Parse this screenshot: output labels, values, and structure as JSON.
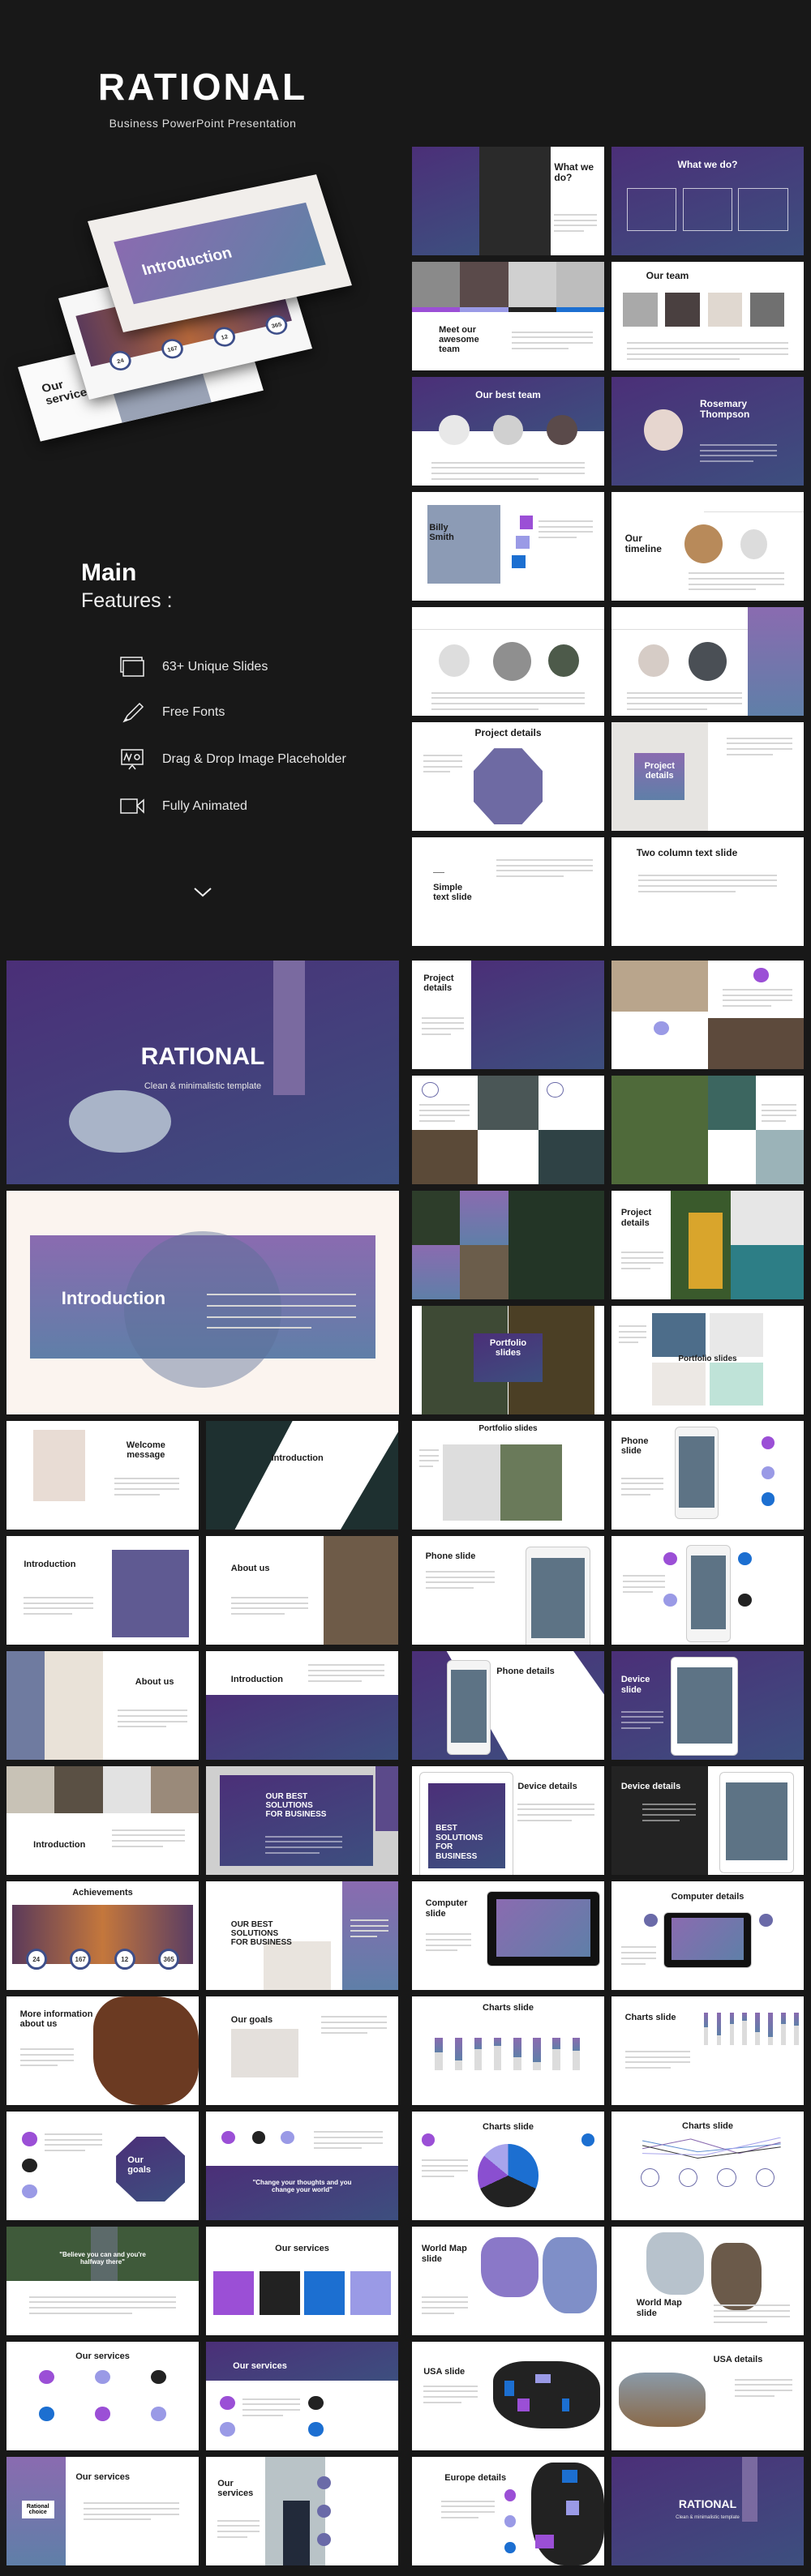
{
  "header": {
    "title": "RATIONAL",
    "subtitle": "Business PowerPoint Presentation"
  },
  "hero_cards": {
    "intro_title": "Introduction",
    "stats": [
      "24",
      "167",
      "12",
      "365"
    ],
    "services_title": "Our services"
  },
  "features": {
    "heading": "Main",
    "subheading": "Features :",
    "items": [
      {
        "label": "63+ Unique Slides",
        "icon": "slides-stack-icon"
      },
      {
        "label": "Free Fonts",
        "icon": "pen-icon"
      },
      {
        "label": "Drag & Drop Image Placeholder",
        "icon": "presentation-board-icon"
      },
      {
        "label": "Fully Animated",
        "icon": "video-camera-icon"
      }
    ],
    "scroll_icon": "chevron-down-icon"
  },
  "colors": {
    "background": "#181818",
    "purple": "#4b2f78",
    "violet": "#9b4fd6",
    "lavender": "#9a9ae6",
    "blue": "#1c6fd1"
  },
  "slides": {
    "whatwedo1": {
      "title": "What we\ndo?"
    },
    "whatwedo2": {
      "title": "What we do?"
    },
    "meet_team": {
      "title": "Meet our\nawesome\nteam"
    },
    "our_team": {
      "title": "Our team"
    },
    "best_team": {
      "title": "Our best team"
    },
    "rosemary": {
      "title": "Rosemary\nThompson"
    },
    "billy": {
      "title": "Billy\nSmith"
    },
    "timeline": {
      "title": "Our\ntimeline"
    },
    "timeline2": {
      "title": ""
    },
    "timeline3": {
      "title": ""
    },
    "project_oct": {
      "title": "Project details"
    },
    "project_box": {
      "title": "Project\ndetails"
    },
    "simple_text": {
      "title": "Simple\ntext slide"
    },
    "two_col": {
      "title": "Two column text slide"
    },
    "cover": {
      "title": "RATIONAL",
      "subtitle": "Clean & minimalistic template"
    },
    "intro_big": {
      "title": "Introduction"
    },
    "welcome": {
      "title": "Welcome\nmessage"
    },
    "intro2": {
      "title": "Introduction"
    },
    "intro3": {
      "title": "Introduction"
    },
    "about1": {
      "title": "About us"
    },
    "about2": {
      "title": "About us"
    },
    "intro4": {
      "title": "Introduction"
    },
    "intro5": {
      "title": "Introduction"
    },
    "solutions1": {
      "title": "OUR BEST\nSOLUTIONS\nFOR BUSINESS"
    },
    "achievements": {
      "title": "Achievements",
      "stats": [
        "24",
        "167",
        "12",
        "365"
      ]
    },
    "solutions2": {
      "title": "OUR BEST\nSOLUTIONS\nFOR BUSINESS"
    },
    "moreinfo": {
      "title": "More information\nabout us"
    },
    "goals1": {
      "title": "Our goals"
    },
    "goals2": {
      "title": "Our\ngoals"
    },
    "quote1": {
      "title": "\"Change your thoughts and you\nchange your world\""
    },
    "quote2": {
      "title": "\"Believe you can and you're\nhalfway there\""
    },
    "services1": {
      "title": "Our services"
    },
    "services2": {
      "title": "Our services"
    },
    "services3": {
      "title": "Our services"
    },
    "services4": {
      "title": "Our services",
      "subtitle": "Rational\nchoice"
    },
    "services5": {
      "title": "Our\nservices"
    },
    "pd1": {
      "title": "Project\ndetails"
    },
    "photos1": {
      "title": ""
    },
    "grid1": {
      "title": ""
    },
    "grid2": {
      "title": ""
    },
    "grid3": {
      "title": ""
    },
    "pd_parrot": {
      "title": "Project\ndetails"
    },
    "portfolio1": {
      "title": "Portfolio\nslides"
    },
    "portfolio2": {
      "title": "Portfolio slides"
    },
    "portfolio3": {
      "title": "Portfolio slides"
    },
    "phone1": {
      "title": "Phone\nslide"
    },
    "phone2": {
      "title": "Phone slide"
    },
    "phone3": {
      "title": ""
    },
    "phone_details": {
      "title": "Phone details"
    },
    "device_slide": {
      "title": "Device\nslide"
    },
    "device1": {
      "title": "Device details",
      "subtitle": "BEST\nSOLUTIONS\nFOR\nBUSINESS"
    },
    "device2": {
      "title": "Device details"
    },
    "computer1": {
      "title": "Computer\nslide"
    },
    "computer2": {
      "title": "Computer details"
    },
    "charts1": {
      "title": "Charts slide"
    },
    "charts2": {
      "title": "Charts slide"
    },
    "charts_pie": {
      "title": "Charts slide"
    },
    "charts_line": {
      "title": "Charts slide"
    },
    "worldmap1": {
      "title": "World Map\nslide"
    },
    "worldmap2": {
      "title": "World Map\nslide"
    },
    "usa1": {
      "title": "USA slide"
    },
    "usa2": {
      "title": "USA details"
    },
    "europe": {
      "title": "Europe details"
    },
    "rational_end": {
      "title": "RATIONAL",
      "subtitle": "Clean & minimalistic template"
    }
  }
}
